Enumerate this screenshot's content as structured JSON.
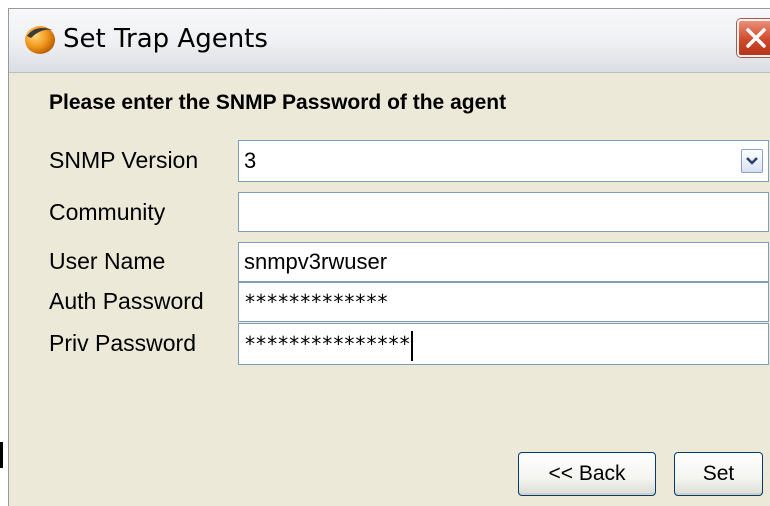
{
  "window": {
    "title": "Set Trap Agents",
    "icon": "orange-sphere-logo"
  },
  "prompt": "Please enter the SNMP Password of the agent",
  "form": {
    "snmp_version": {
      "label": "SNMP Version",
      "value": "3"
    },
    "community": {
      "label": "Community",
      "value": ""
    },
    "user_name": {
      "label": "User Name",
      "value": "snmpv3rwuser"
    },
    "auth_password": {
      "label": "Auth Password",
      "value": "*************"
    },
    "priv_password": {
      "label": "Priv Password",
      "value": "***************"
    }
  },
  "buttons": {
    "back": "<< Back",
    "set": "Set"
  },
  "colors": {
    "close_red": "#cf4a2c",
    "field_border": "#7f9db9",
    "dialog_bg": "#ece9d8"
  }
}
